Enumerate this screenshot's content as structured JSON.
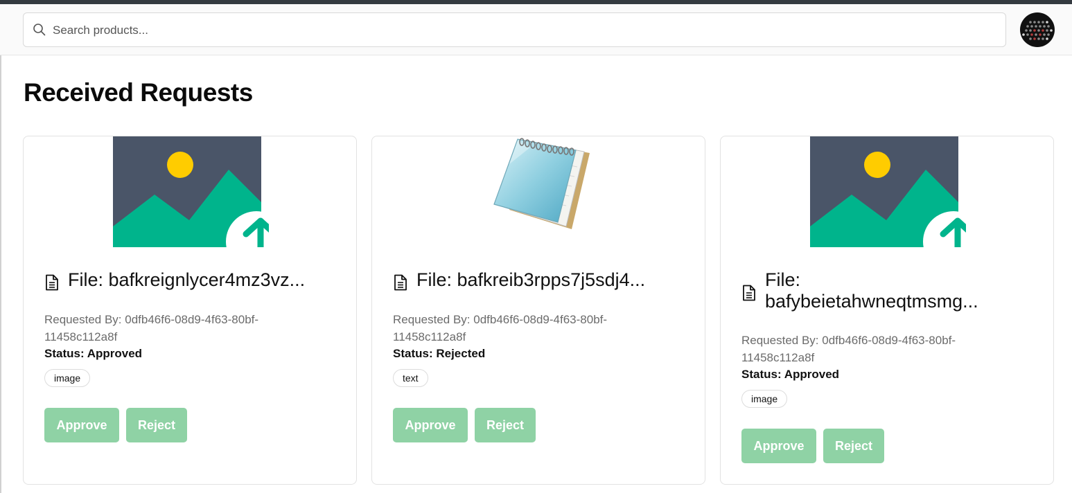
{
  "header": {
    "search": {
      "placeholder": "Search products...",
      "value": ""
    },
    "avatar_icon": "avatar-dots-icon"
  },
  "page": {
    "title": "Received Requests"
  },
  "colors": {
    "top_strip": "#343a40",
    "button_bg": "#8fd2a5",
    "image_bg": "#4a5568",
    "image_green": "#00b48c",
    "sun": "#ffcc00"
  },
  "cards": [
    {
      "thumbnail_icon": "image-upload-icon",
      "file_label": "File: bafkreignlycer4mz3vz...",
      "requested_by": "Requested By: 0dfb46f6-08d9-4f63-80bf-11458c112a8f",
      "status": "Status: Approved",
      "tag": "image",
      "approve_label": "Approve",
      "reject_label": "Reject"
    },
    {
      "thumbnail_icon": "notepad-icon",
      "file_label": "File: bafkreib3rpps7j5sdj4...",
      "requested_by": "Requested By: 0dfb46f6-08d9-4f63-80bf-11458c112a8f",
      "status": "Status: Rejected",
      "tag": "text",
      "approve_label": "Approve",
      "reject_label": "Reject"
    },
    {
      "thumbnail_icon": "image-upload-icon",
      "file_label": "File:\nbafybeietahwneqtmsmg...",
      "requested_by": "Requested By: 0dfb46f6-08d9-4f63-80bf-11458c112a8f",
      "status": "Status: Approved",
      "tag": "image",
      "approve_label": "Approve",
      "reject_label": "Reject"
    }
  ]
}
